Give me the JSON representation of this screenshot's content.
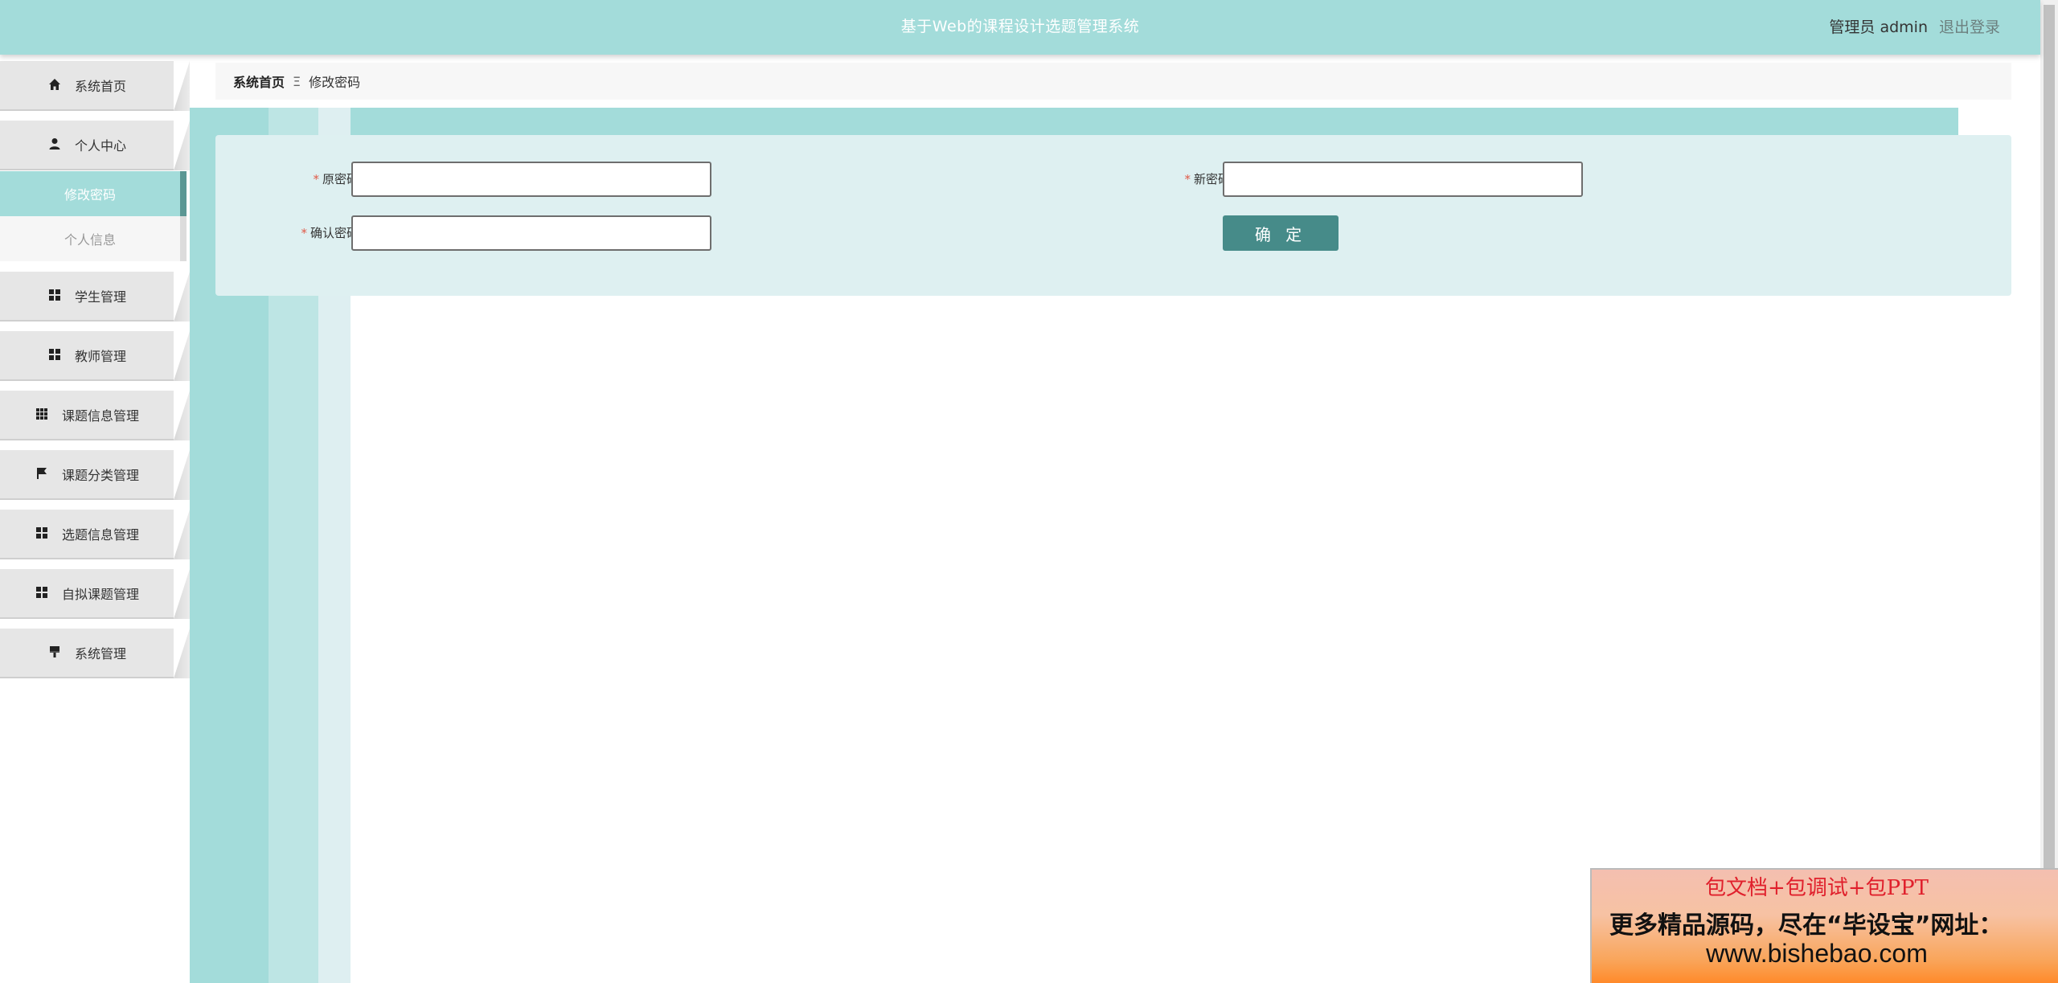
{
  "header": {
    "title": "基于Web的课程设计选题管理系统",
    "user": "管理员 admin",
    "logout": "退出登录"
  },
  "sidebar": {
    "items": [
      {
        "label": "系统首页",
        "icon": "home-icon"
      },
      {
        "label": "个人中心",
        "icon": "user-icon"
      },
      {
        "label": "学生管理",
        "icon": "grid-icon"
      },
      {
        "label": "教师管理",
        "icon": "grid-icon"
      },
      {
        "label": "课题信息管理",
        "icon": "apps-icon"
      },
      {
        "label": "课题分类管理",
        "icon": "flag-icon"
      },
      {
        "label": "选题信息管理",
        "icon": "grid-icon"
      },
      {
        "label": "自拟课题管理",
        "icon": "grid-icon"
      },
      {
        "label": "系统管理",
        "icon": "brush-icon"
      }
    ],
    "submenu": [
      {
        "label": "修改密码",
        "active": true
      },
      {
        "label": "个人信息",
        "active": false
      }
    ]
  },
  "breadcrumb": {
    "home": "系统首页",
    "separator": "Ξ",
    "current": "修改密码"
  },
  "form": {
    "old_password_label": "原密码",
    "new_password_label": "新密码",
    "confirm_password_label": "确认密码",
    "required_mark": "*",
    "old_password_value": "",
    "new_password_value": "",
    "confirm_password_value": "",
    "submit_label": "确 定"
  },
  "promo": {
    "line1": "包文档+包调试+包PPT",
    "line2": "更多精品源码，尽在“毕设宝”网址：",
    "line3": "www.bishebao.com"
  },
  "colors": {
    "accent": "#a3dcda",
    "button": "#468b89",
    "panel": "#def0f1",
    "required": "#e05a48"
  }
}
